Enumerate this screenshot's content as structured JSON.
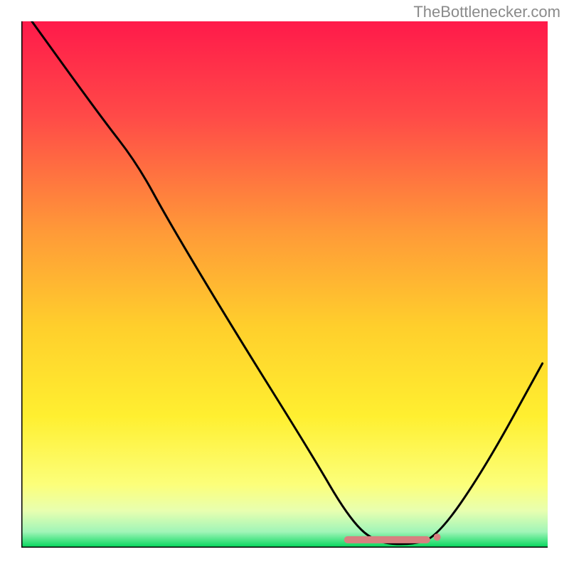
{
  "watermark": "TheBottlenecker.com",
  "chart_data": {
    "type": "line",
    "title": "",
    "xlabel": "",
    "ylabel": "",
    "xlim": [
      0,
      100
    ],
    "ylim": [
      0,
      100
    ],
    "background_gradient": {
      "top": "#ff1a4a",
      "mid_upper": "#ff7a3a",
      "mid": "#ffdb2a",
      "mid_lower": "#ffff66",
      "bottom": "#00d65a"
    },
    "curve": [
      {
        "x": 2,
        "y": 100
      },
      {
        "x": 15,
        "y": 82
      },
      {
        "x": 22,
        "y": 73
      },
      {
        "x": 28,
        "y": 62
      },
      {
        "x": 40,
        "y": 42
      },
      {
        "x": 55,
        "y": 18
      },
      {
        "x": 62,
        "y": 6
      },
      {
        "x": 67,
        "y": 1
      },
      {
        "x": 74,
        "y": 0.5
      },
      {
        "x": 79,
        "y": 2
      },
      {
        "x": 88,
        "y": 15
      },
      {
        "x": 99,
        "y": 35
      }
    ],
    "marker_segment": {
      "x_start": 62,
      "x_end": 77,
      "y": 1.5,
      "dot_x": 79,
      "dot_y": 2,
      "color": "#d88080"
    }
  }
}
